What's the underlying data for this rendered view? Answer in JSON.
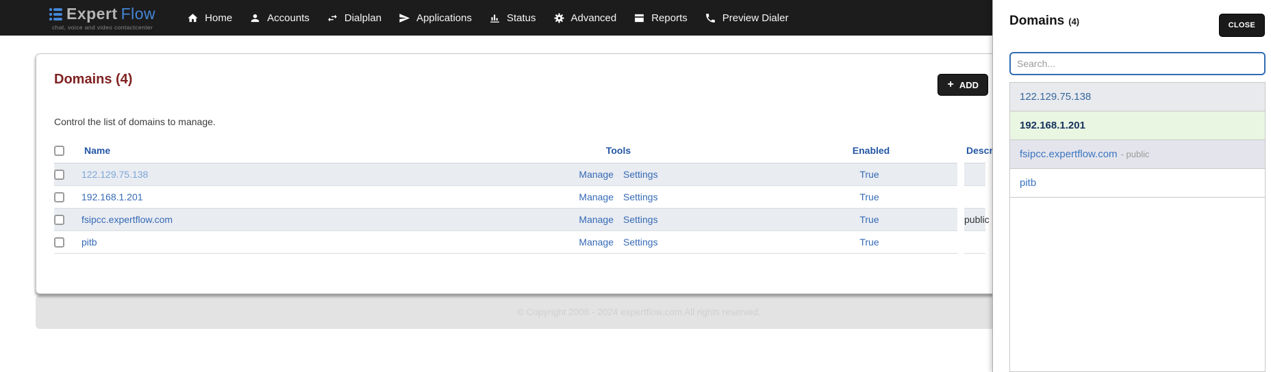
{
  "brand": {
    "name_primary": "Expert",
    "name_secondary": "Flow",
    "tagline": "chat, voice and video contactcenter"
  },
  "nav": {
    "items": [
      {
        "label": "Home",
        "icon": "home-icon"
      },
      {
        "label": "Accounts",
        "icon": "person-icon"
      },
      {
        "label": "Dialplan",
        "icon": "swap-arrows-icon"
      },
      {
        "label": "Applications",
        "icon": "paper-plane-icon"
      },
      {
        "label": "Status",
        "icon": "bar-chart-icon"
      },
      {
        "label": "Advanced",
        "icon": "gear-icon"
      },
      {
        "label": "Reports",
        "icon": "book-icon"
      },
      {
        "label": "Preview Dialer",
        "icon": "phone-icon"
      }
    ]
  },
  "page": {
    "heading": "Domains (4)",
    "subtitle": "Control the list of domains to manage.",
    "add_button": {
      "plus": "+",
      "label": "ADD"
    },
    "table": {
      "headers": [
        "Name",
        "Tools",
        "Enabled",
        "Description"
      ],
      "rows": [
        {
          "name": "122.129.75.138",
          "tools": [
            "Manage",
            "Settings"
          ],
          "enabled": "True",
          "description": ""
        },
        {
          "name": "192.168.1.201",
          "tools": [
            "Manage",
            "Settings"
          ],
          "enabled": "True",
          "description": ""
        },
        {
          "name": "fsipcc.expertflow.com",
          "tools": [
            "Manage",
            "Settings"
          ],
          "enabled": "True",
          "description": "public"
        },
        {
          "name": "pitb",
          "tools": [
            "Manage",
            "Settings"
          ],
          "enabled": "True",
          "description": ""
        }
      ]
    },
    "footer": "© Copyright 2008 - 2024 expertflow.com All rights reserved."
  },
  "panel": {
    "title": "Domains",
    "count": "(4)",
    "close_label": "CLOSE",
    "search_placeholder": "Search...",
    "items": [
      {
        "label": "122.129.75.138",
        "suffix": ""
      },
      {
        "label": "192.168.1.201",
        "suffix": ""
      },
      {
        "label": "fsipcc.expertflow.com",
        "suffix": "- public"
      },
      {
        "label": "pitb",
        "suffix": ""
      }
    ]
  },
  "colors": {
    "navbar_bg": "#1c1c1c",
    "brand_blue": "#4486d8",
    "heading_maroon": "#7f2121",
    "table_header_blue": "#2456a4",
    "link_blue": "#3569b5",
    "row_stripe": "#e9ecf1",
    "selected_green": "#e9f6e2",
    "search_border_blue": "#2f6cb3",
    "footer_bg": "#e3e3e3"
  }
}
